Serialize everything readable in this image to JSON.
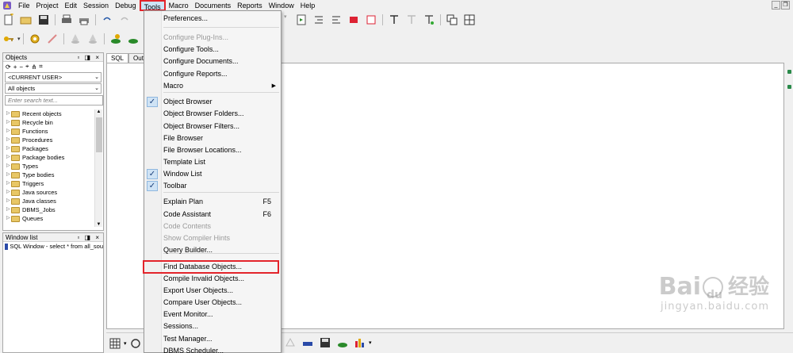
{
  "menubar": {
    "items": [
      "File",
      "Project",
      "Edit",
      "Session",
      "Debug",
      "Tools",
      "Macro",
      "Documents",
      "Reports",
      "Window",
      "Help"
    ],
    "active": "Tools"
  },
  "tools_menu": {
    "items": [
      {
        "label": "Preferences...",
        "enabled": true
      },
      {
        "label": "Configure Plug-Ins...",
        "enabled": false
      },
      {
        "label": "Configure Tools...",
        "enabled": true
      },
      {
        "label": "Configure Documents...",
        "enabled": true
      },
      {
        "label": "Configure Reports...",
        "enabled": true
      },
      {
        "label": "Macro",
        "enabled": true,
        "submenu": true
      },
      {
        "label": "Object Browser",
        "enabled": true,
        "checked": true
      },
      {
        "label": "Object Browser Folders...",
        "enabled": true
      },
      {
        "label": "Object Browser Filters...",
        "enabled": true
      },
      {
        "label": "File Browser",
        "enabled": true
      },
      {
        "label": "File Browser Locations...",
        "enabled": true
      },
      {
        "label": "Template List",
        "enabled": true
      },
      {
        "label": "Window List",
        "enabled": true,
        "checked": true
      },
      {
        "label": "Toolbar",
        "enabled": true,
        "checked": true
      },
      {
        "label": "Explain Plan",
        "enabled": true,
        "shortcut": "F5"
      },
      {
        "label": "Code Assistant",
        "enabled": true,
        "shortcut": "F6"
      },
      {
        "label": "Code Contents",
        "enabled": false
      },
      {
        "label": "Show Compiler Hints",
        "enabled": false
      },
      {
        "label": "Query Builder...",
        "enabled": true
      },
      {
        "label": "Find Database Objects...",
        "enabled": true,
        "highlighted": true
      },
      {
        "label": "Compile Invalid Objects...",
        "enabled": true
      },
      {
        "label": "Export User Objects...",
        "enabled": true
      },
      {
        "label": "Compare User Objects...",
        "enabled": true
      },
      {
        "label": "Event Monitor...",
        "enabled": true
      },
      {
        "label": "Sessions...",
        "enabled": true
      },
      {
        "label": "Test Manager...",
        "enabled": true
      },
      {
        "label": "DBMS Scheduler...",
        "enabled": true
      }
    ]
  },
  "objects_panel": {
    "title": "Objects",
    "user_combo": "<CURRENT USER>",
    "filter_combo": "All objects",
    "search_placeholder": "Enter search text...",
    "tree": [
      "Recent objects",
      "Recycle bin",
      "Functions",
      "Procedures",
      "Packages",
      "Package bodies",
      "Types",
      "Type bodies",
      "Triggers",
      "Java sources",
      "Java classes",
      "DBMS_Jobs",
      "Queues"
    ]
  },
  "window_list": {
    "title": "Window list",
    "items": [
      "SQL Window - select * from all_sou"
    ]
  },
  "editor": {
    "tabs": [
      "SQL",
      "Outp"
    ]
  },
  "watermark": {
    "brand": "Bai",
    "brand2": "du",
    "cn": "经验",
    "url": "jingyan.baidu.com"
  },
  "colors": {
    "highlight_red": "#e3242b",
    "check_blue": "#cfe3f5"
  }
}
